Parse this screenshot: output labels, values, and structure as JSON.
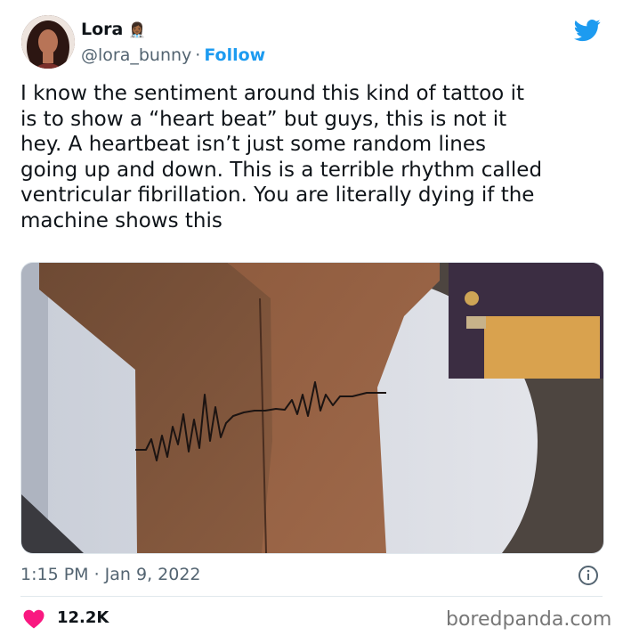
{
  "author": {
    "name": "Lora",
    "emoji": "👩🏾‍⚕️",
    "handle": "@lora_bunny",
    "separator": "·",
    "follow_label": "Follow"
  },
  "tweet": {
    "text": "I know the sentiment around this kind of tattoo it\nis to show a “heart beat” but guys, this is not it\nhey. A heartbeat isn’t just some random lines\ngoing up and down. This is a terrible rhythm called\nventricular fibrillation. You are literally dying if the\nmachine shows this",
    "timestamp": "1:15 PM · Jan 9, 2022",
    "likes": "12.2K"
  },
  "watermark": "boredpanda.com",
  "icons": {
    "brand": "twitter-bird-icon",
    "info": "info-icon",
    "like": "heart-icon"
  },
  "colors": {
    "accent": "#1d9bf0",
    "like": "#f91880",
    "muted": "#536471"
  }
}
